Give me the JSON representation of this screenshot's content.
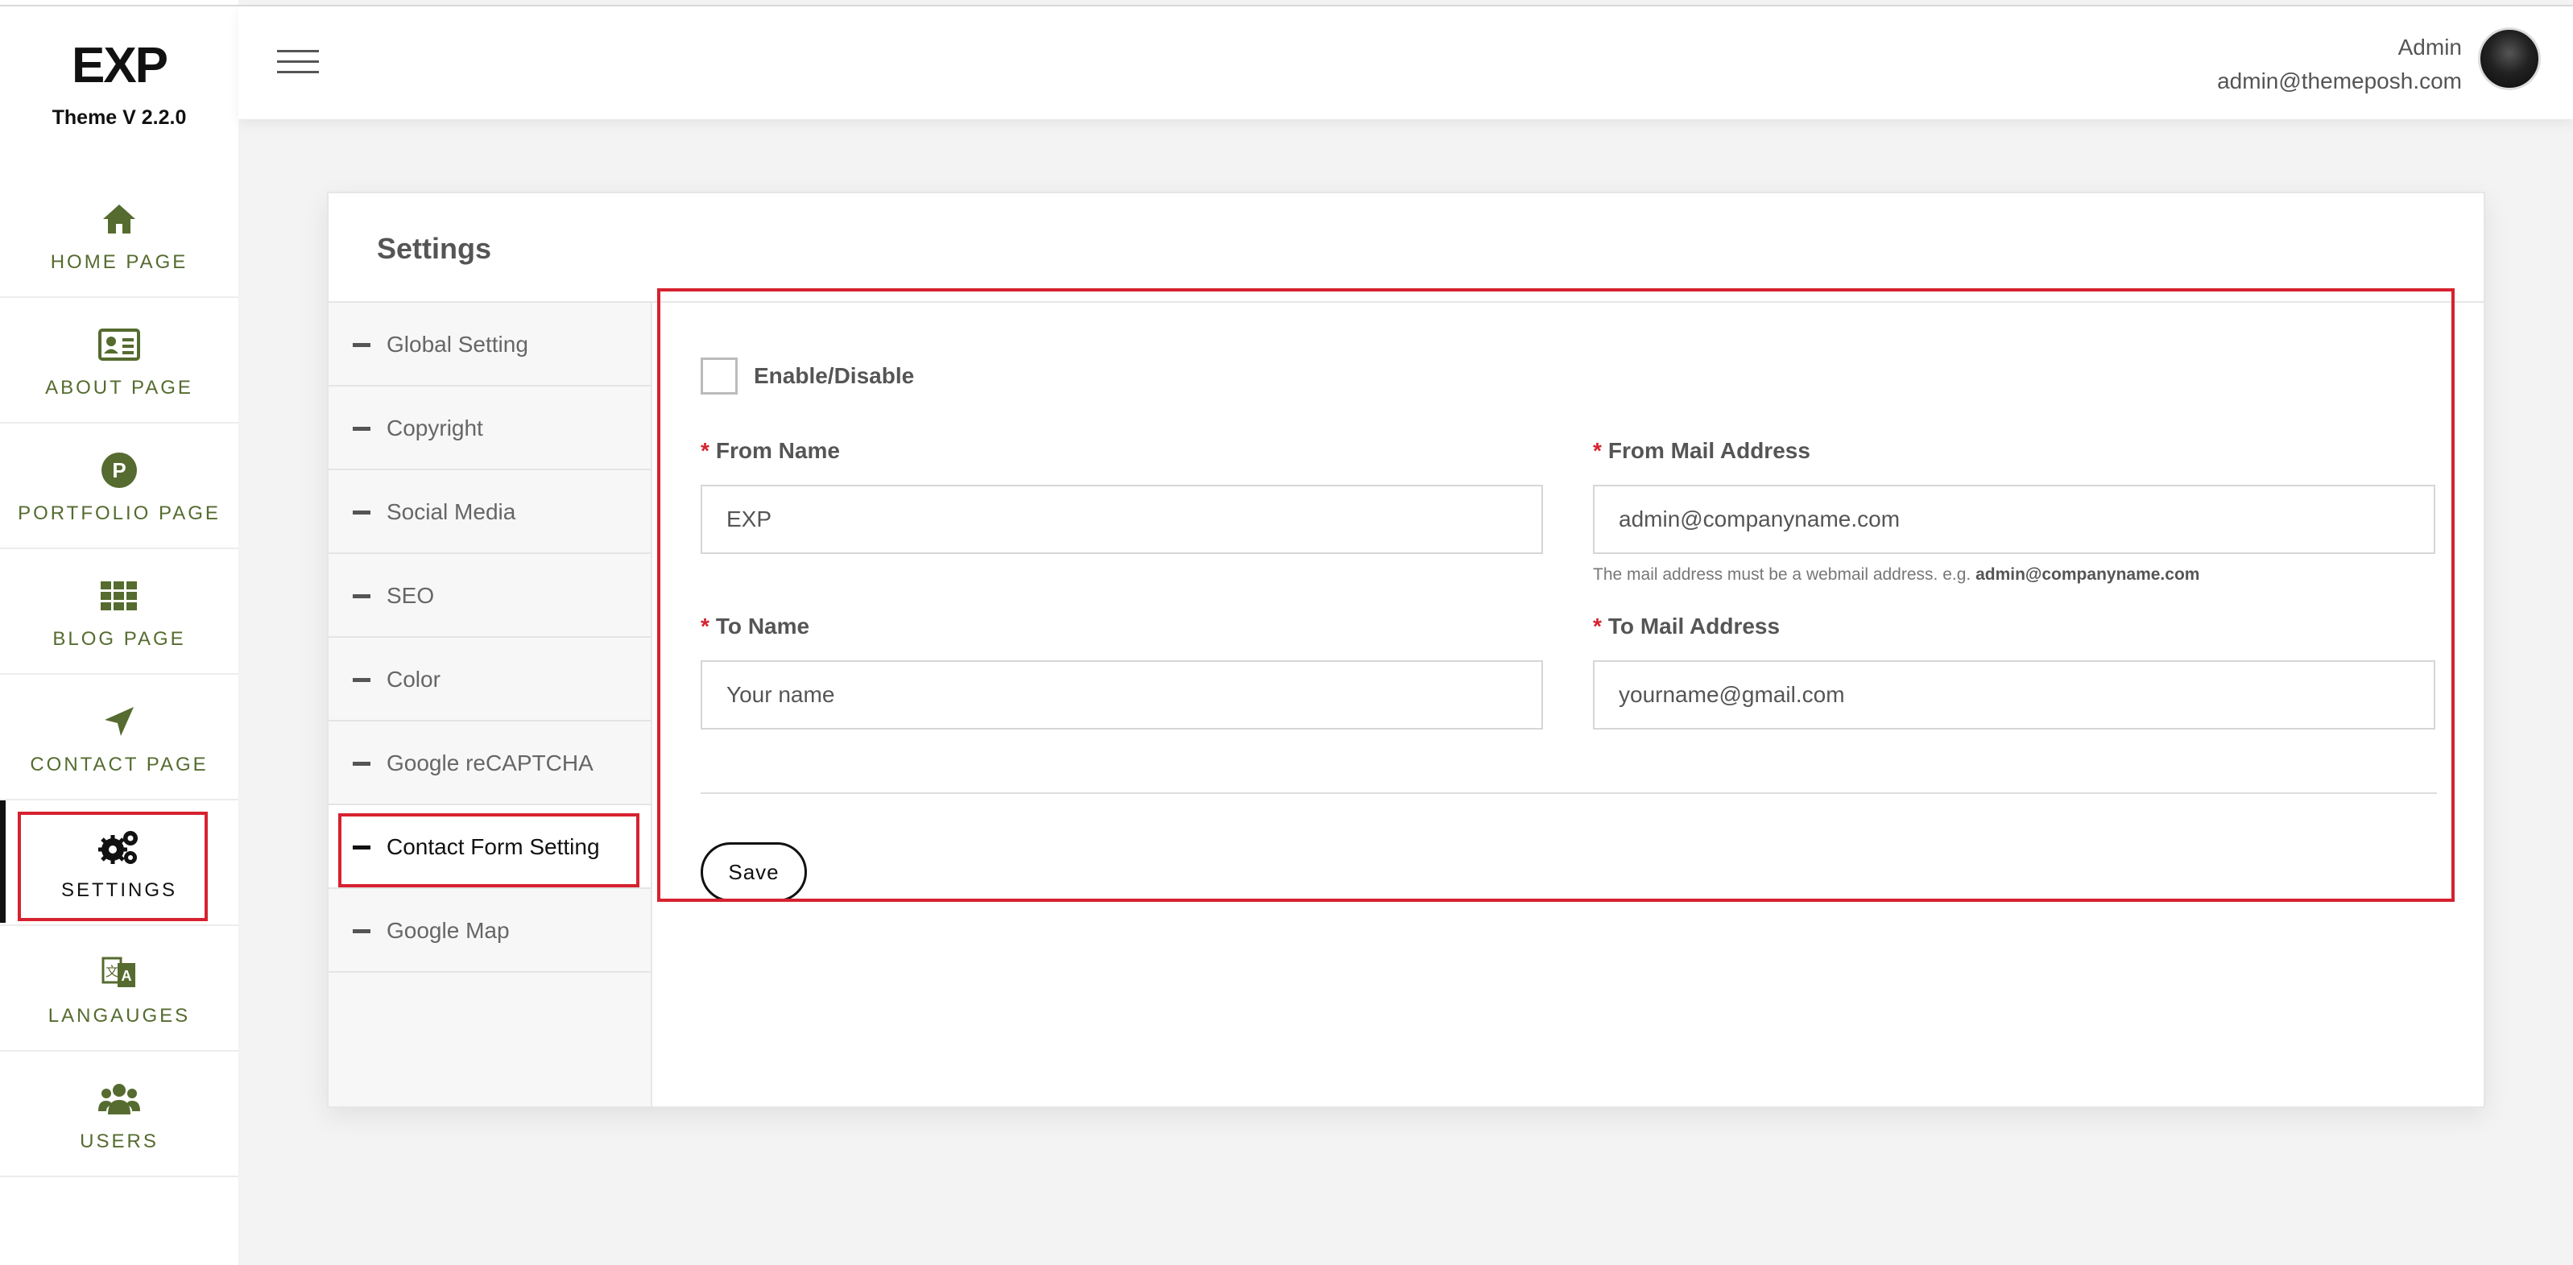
{
  "brand": {
    "logo": "EXP",
    "version": "Theme V 2.2.0"
  },
  "nav": [
    {
      "label": "HOME PAGE",
      "icon": "home-icon"
    },
    {
      "label": "ABOUT PAGE",
      "icon": "id-card-icon"
    },
    {
      "label": "PORTFOLIO PAGE",
      "icon": "portfolio-p-icon"
    },
    {
      "label": "BLOG PAGE",
      "icon": "grid-icon"
    },
    {
      "label": "CONTACT PAGE",
      "icon": "location-arrow-icon"
    },
    {
      "label": "SETTINGS",
      "icon": "gears-icon"
    },
    {
      "label": "LANGAUGES",
      "icon": "language-icon"
    },
    {
      "label": "USERS",
      "icon": "users-icon"
    }
  ],
  "user": {
    "name": "Admin",
    "email": "admin@themeposh.com"
  },
  "card": {
    "title": "Settings"
  },
  "tabs": [
    {
      "label": "Global Setting"
    },
    {
      "label": "Copyright"
    },
    {
      "label": "Social Media"
    },
    {
      "label": "SEO"
    },
    {
      "label": "Color"
    },
    {
      "label": "Google reCAPTCHA"
    },
    {
      "label": "Contact Form Setting"
    },
    {
      "label": "Google Map"
    }
  ],
  "form": {
    "enable_label": "Enable/Disable",
    "required_mark": "*",
    "from_name": {
      "label": "From Name",
      "value": "EXP"
    },
    "from_mail": {
      "label": "From Mail Address",
      "value": "admin@companyname.com",
      "help": "The mail address must be a webmail address. e.g.",
      "help_example": "admin@companyname.com"
    },
    "to_name": {
      "label": "To Name",
      "value": "Your name"
    },
    "to_mail": {
      "label": "To Mail Address",
      "value": "yourname@gmail.com"
    },
    "save_label": "Save"
  },
  "colors": {
    "accent": "#556b2f",
    "highlight": "#d6222f"
  }
}
